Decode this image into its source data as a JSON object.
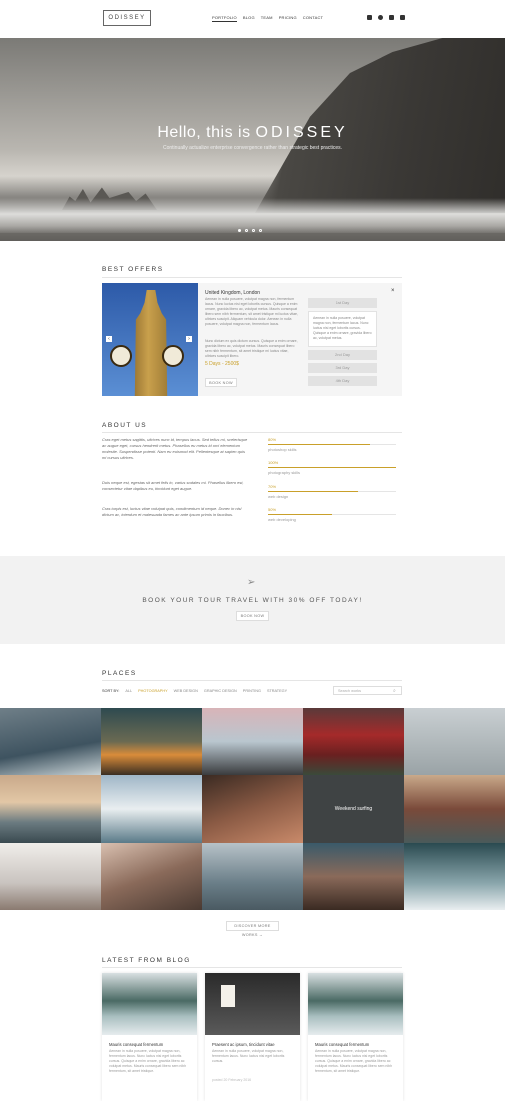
{
  "brand": {
    "logo": "ODISSEY"
  },
  "nav": {
    "items": [
      "PORTFOLIO",
      "BLOG",
      "TEAM",
      "PRICING",
      "CONTACT"
    ],
    "active": "PORTFOLIO"
  },
  "social": [
    "instagram-icon",
    "dribbble-icon",
    "linkedin-icon",
    "twitter-icon"
  ],
  "hero": {
    "title_prefix": "Hello, this is",
    "title_brand": "ODISSEY",
    "subtitle": "Continually actualize enterprise convergence rather than strategic best practices.",
    "slides": 4,
    "active_slide": 1
  },
  "offers": {
    "title": "BEST OFFERS",
    "location": "United Kingdom, London",
    "text1": "Aenean in nulla posuere, volutpat magna non, fermentum lacus. Nunc luctus nisi eget lobortis cursus. Quisque a enim ornare, gravida libero ac, volutpat metus. Mauris consequat libero sem nibh fermentum, sit amet tristique mi luctus vitae, ultrices suscipit. Aliquam vehicula dolor. Aenean in nulla posuere, volutpat magna non, fermentum lacus.",
    "text2": "Nunc dictum ex quis dictum cursus. Quisque a enim ornare, gravida libero ac, volutpat metus. Mauris consequat libero sem nibh fermentum, sit amet tristique mi luctus vitae, ultrices suscipit libero.",
    "price": "5 Days - 2500$",
    "book_label": "BOOK NOW",
    "day_tabs": [
      "1st Day",
      "2nd Day",
      "3rd Day",
      "4th Day"
    ],
    "day_box": "Aenean in nulla posuere, volutpat magna non, fermentum lacus. Nunc luctus nisi eget lobortis cursus. Quisque a enim ornare, gravida libero ac, volutpat metus."
  },
  "about": {
    "title": "ABOUT US",
    "p1": "Cras eget metus sagittis, ultrices nunc id, tempus lacus. Sed tellus mi, scelerisque ac augue eget, cursus hendrerit metus. Phasellus eu metus id orci elementum molestie. Suspendisse potenti. Nam eu euismod elit. Pellentesque at sapien quis mi cursus ultrices.",
    "p2": "Duis neque est, egestas sit amet felis in, varius sodales mi. Phasellus libero est, consectetur vitae dapibus eu, tincidunt eget augue.",
    "p3": "Cras turpis est, luctus vitae volutpat quis, condimentum id neque. Donec in nisl dictum ac, interdum et malesuada fames ac ante ipsum primis in faucibus.",
    "skills": [
      {
        "pct": "80%",
        "value": 0.8,
        "label": "photoshop skills"
      },
      {
        "pct": "100%",
        "value": 1.0,
        "label": "photography skills"
      },
      {
        "pct": "70%",
        "value": 0.7,
        "label": "web design"
      },
      {
        "pct": "50%",
        "value": 0.5,
        "label": "web developing"
      }
    ]
  },
  "promo": {
    "title": "BOOK YOUR TOUR TRAVEL WITH 30% OFF TODAY!",
    "button": "BOOK NOW"
  },
  "places": {
    "title": "PLACES",
    "sort_label": "SORT BY:",
    "filters": [
      "ALL",
      "PHOTOGRAPHY",
      "WEB DESIGN",
      "GRAPHIC DESIGN",
      "PRINTING",
      "STRATEGY"
    ],
    "active_filter": "PHOTOGRAPHY",
    "search_placeholder": "Search works",
    "tile_caption": "Weekend surfing",
    "discover": "DISCOVER MORE WORKS →"
  },
  "blog": {
    "title": "LATEST FROM BLOG",
    "posts": [
      {
        "title": "Mauris consequat fermentum",
        "body": "Aenean in nulla posuere, volutpat magna non, fermentum lacus. Nunc luctus nisi eget lobortis cursus. Quisque a enim ornare, gravida libero ac volutpat metus. Mauris consequat libero sem nibh fermentum, sit amet tristique."
      },
      {
        "title": "Praesent ac ipsum, tincidunt vitae",
        "body": "Aenean in nulla posuere, volutpat magna non, fermentum lacus. Nunc luctus nisi eget lobortis cursus.",
        "meta": "posted 20 February 2016"
      },
      {
        "title": "Mauris consequat fermentum",
        "body": "Aenean in nulla posuere, volutpat magna non, fermentum lacus. Nunc luctus nisi eget lobortis cursus. Quisque a enim ornare, gravida libero ac volutpat metus. Mauris consequat libero sem nibh fermentum, sit amet tristique."
      }
    ]
  },
  "colors": {
    "accent": "#c9a02a",
    "band": "#f2f2f2"
  }
}
